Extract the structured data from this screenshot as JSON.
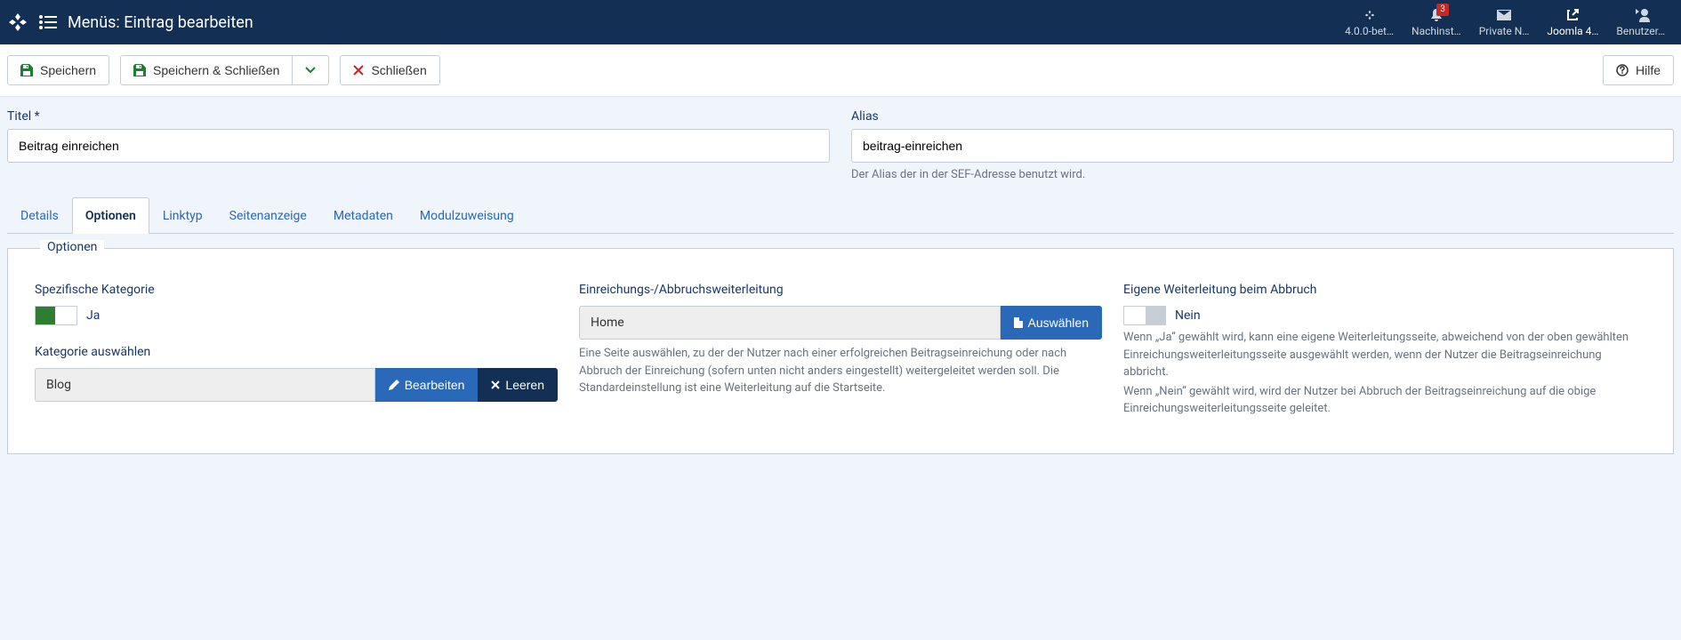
{
  "header": {
    "title": "Menüs: Eintrag bearbeiten",
    "items": [
      {
        "label": "4.0.0-bet…",
        "icon": "joomla"
      },
      {
        "label": "Nachinst…",
        "icon": "bell",
        "badge": "3"
      },
      {
        "label": "Private N…",
        "icon": "envelope"
      },
      {
        "label": "Joomla 4…",
        "icon": "external",
        "active": true
      },
      {
        "label": "Benutzer…",
        "icon": "user"
      }
    ]
  },
  "toolbar": {
    "save": "Speichern",
    "save_close": "Speichern & Schließen",
    "close": "Schließen",
    "help": "Hilfe"
  },
  "title_field": {
    "label": "Titel *",
    "value": "Beitrag einreichen"
  },
  "alias_field": {
    "label": "Alias",
    "value": "beitrag-einreichen",
    "hint": "Der Alias der in der SEF-Adresse benutzt wird."
  },
  "tabs": [
    {
      "label": "Details",
      "active": false
    },
    {
      "label": "Optionen",
      "active": true
    },
    {
      "label": "Linktyp",
      "active": false
    },
    {
      "label": "Seitenanzeige",
      "active": false
    },
    {
      "label": "Metadaten",
      "active": false
    },
    {
      "label": "Modulzuweisung",
      "active": false
    }
  ],
  "fieldset": {
    "legend": "Optionen",
    "specific_category": {
      "label": "Spezifische Kategorie",
      "state_label": "Ja"
    },
    "select_category": {
      "label": "Kategorie auswählen",
      "value": "Blog",
      "edit": "Bearbeiten",
      "clear": "Leeren"
    },
    "redirect": {
      "label": "Einreichungs-/Abbruchsweiterleitung",
      "value": "Home",
      "select": "Auswählen",
      "hint": "Eine Seite auswählen, zu der der Nutzer nach einer erfolgreichen Beitragseinreichung oder nach Abbruch der Einreichung (sofern unten nicht anders eingestellt) weitergeleitet werden soll. Die Standardeinstellung ist eine Weiterleitung auf die Startseite."
    },
    "custom_cancel": {
      "label": "Eigene Weiterleitung beim Abbruch",
      "state_label": "Nein",
      "hint1": "Wenn „Ja“ gewählt wird, kann eine eigene Weiterleitungsseite, abweichend von der oben gewählten Einreichungsweiterleitungsseite ausgewählt werden, wenn der Nutzer die Beitragseinreichung abbricht.",
      "hint2": "Wenn „Nein“ gewählt wird, wird der Nutzer bei Abbruch der Beitragseinreichung auf die obige Einreichungsweiterleitungsseite geleitet."
    }
  }
}
